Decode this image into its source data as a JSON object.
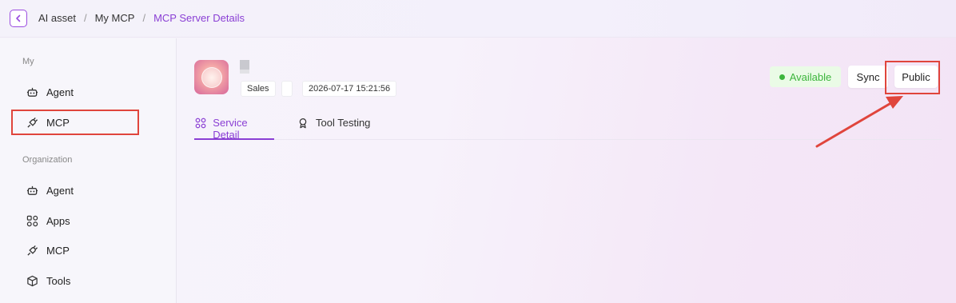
{
  "breadcrumb": {
    "items": [
      "AI asset",
      "My MCP"
    ],
    "separator": "/",
    "current": "MCP Server Details"
  },
  "sidebar": {
    "my_label": "My",
    "my_items": [
      {
        "label": "Agent",
        "icon": "robot-icon"
      },
      {
        "label": "MCP",
        "icon": "plug-icon"
      }
    ],
    "org_label": "Organization",
    "org_items": [
      {
        "label": "Agent",
        "icon": "robot-icon"
      },
      {
        "label": "Apps",
        "icon": "apps-grid-icon"
      },
      {
        "label": "MCP",
        "icon": "plug-icon"
      },
      {
        "label": "Tools",
        "icon": "cube-icon"
      }
    ]
  },
  "server": {
    "tag": "Sales",
    "timestamp": "2026-07-17 15:21:56",
    "status": "Available"
  },
  "actions": {
    "sync_label": "Sync",
    "public_label": "Public"
  },
  "tabs": [
    {
      "label": "Service Detail",
      "icon": "grid-icon",
      "active": true
    },
    {
      "label": "Tool Testing",
      "icon": "badge-icon",
      "active": false
    }
  ],
  "colors": {
    "accent": "#8a3fd4",
    "highlight": "#e0453c",
    "status_green": "#3cb53c"
  }
}
